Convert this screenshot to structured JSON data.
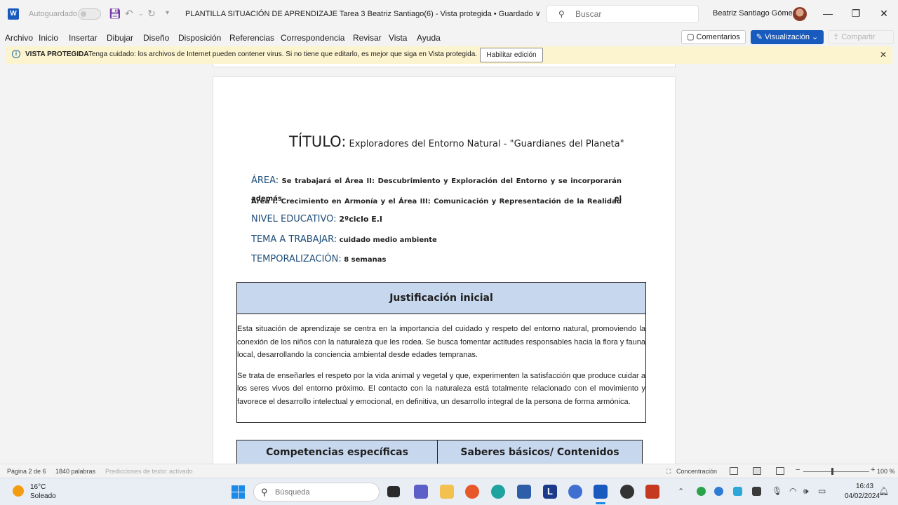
{
  "titlebar": {
    "app_icon": "word-icon",
    "autosave_label": "Autoguardado",
    "document_title": "PLANTILLA SITUACIÓN DE APRENDIZAJE Tarea 3 Beatriz Santiago(6)  -  Vista protegida • Guardado ∨",
    "search_placeholder": "Buscar",
    "user_name": "Beatriz Santiago Gómez",
    "minimize": "—",
    "maximize": "❐",
    "close": "✕"
  },
  "menubar": {
    "items": [
      "Archivo",
      "Inicio",
      "Insertar",
      "Dibujar",
      "Diseño",
      "Disposición",
      "Referencias",
      "Correspondencia",
      "Revisar",
      "Vista",
      "Ayuda"
    ],
    "comments_label": "▢ Comentarios",
    "view_mode_label": "✎ Visualización ⌄",
    "share_label": "⇪ Compartir"
  },
  "protected_bar": {
    "label": "VISTA PROTEGIDA",
    "message": "Tenga cuidado: los archivos de Internet pueden contener virus. Si no tiene que editarlo, es mejor que siga en Vista protegida.",
    "enable_button": "Habilitar edición"
  },
  "document": {
    "title_label": "TÍTULO:",
    "title_value": " Exploradores del Entorno Natural - \"Guardianes del Planeta\"",
    "area_label": "ÁREA:",
    "area_value_line1": "Se trabajará el Área II: Descubrimiento y Exploración del Entorno y se incorporarán además el",
    "area_value_line2": "Área I: Crecimiento en Armonía y el Área III: Comunicación y Representación de la Realidad",
    "nivel_label": "NIVEL EDUCATIVO:",
    "nivel_value": " 2ºciclo E.I",
    "tema_label": "TEMA A TRABAJAR:",
    "tema_value": " cuidado medio ambiente",
    "temp_label": "TEMPORALIZACIÓN:",
    "temp_value": " 8 semanas",
    "justificacion_header": "Justificación inicial",
    "justificacion_p1": "Esta situación de aprendizaje se centra en la importancia del cuidado y respeto del entorno natural, promoviendo la conexión de los niños con la naturaleza que les rodea. Se busca fomentar actitudes responsables hacia la flora y fauna local, desarrollando la conciencia ambiental desde edades tempranas.",
    "justificacion_p2": "Se trata de enseñarles el respeto por la vida animal y vegetal y que, experimenten la satisfacción que produce cuidar a los seres vivos del entorno próximo. El contacto con la naturaleza está totalmente relacionado con el movimiento y favorece el desarrollo intelectual y emocional, en definitiva, un desarrollo integral de la persona de forma armónica.",
    "competencias_header": "Competencias específicas",
    "saberes_header": "Saberes básicos/ Contenidos"
  },
  "statusbar": {
    "page": "Página 2 de 6",
    "words": "1840 palabras",
    "predictions": "Predicciones de texto: activado",
    "focus": "Concentración",
    "zoom": "100 %"
  },
  "taskbar": {
    "weather_temp": "16°C",
    "weather_desc": "Soleado",
    "search_placeholder": "Búsqueda",
    "time": "16:43",
    "date": "04/02/2024"
  }
}
